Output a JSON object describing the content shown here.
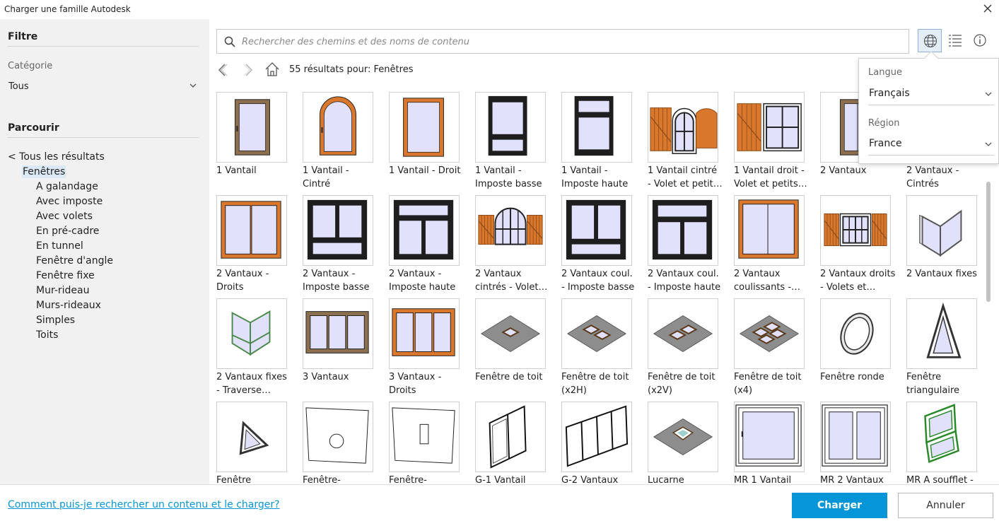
{
  "window": {
    "title": "Charger une famille Autodesk"
  },
  "sidebar": {
    "filter_heading": "Filtre",
    "category_label": "Catégorie",
    "category_value": "Tous",
    "browse_heading": "Parcourir",
    "all_results": "< Tous les résultats",
    "current": "Fenêtres",
    "subcategories": [
      "A galandage",
      "Avec imposte",
      "Avec volets",
      "En pré-cadre",
      "En tunnel",
      "Fenêtre d'angle",
      "Fenêtre fixe",
      "Mur-rideau",
      "Murs-rideaux",
      "Simples",
      "Toits"
    ]
  },
  "search": {
    "placeholder": "Rechercher des chemins et des noms de contenu",
    "value": ""
  },
  "results": {
    "count_text": "55 résultats",
    "pour": "pour:",
    "query": "Fenêtres"
  },
  "popup": {
    "language_label": "Langue",
    "language_value": "Français",
    "region_label": "Région",
    "region_value": "France"
  },
  "items": [
    {
      "l1": "1 Vantail",
      "l2": "",
      "icon": "window-1-vantail"
    },
    {
      "l1": "1 Vantail -",
      "l2": "Cintré",
      "icon": "window-arched"
    },
    {
      "l1": "1 Vantail - Droit",
      "l2": "",
      "icon": "window-1-droit"
    },
    {
      "l1": "1 Vantail -",
      "l2": "Imposte basse",
      "icon": "window-imposte-basse"
    },
    {
      "l1": "1 Vantail -",
      "l2": "Imposte haute",
      "icon": "window-imposte-haute"
    },
    {
      "l1": "1 Vantail cintré",
      "l2": "- Volet et petit…",
      "icon": "window-shutters-arched"
    },
    {
      "l1": "1 Vantail droit -",
      "l2": "Volet et petits…",
      "icon": "window-shutters"
    },
    {
      "l1": "2 Vantaux",
      "l2": "",
      "icon": "window-2-vantaux"
    },
    {
      "l1": "2 Vantaux -",
      "l2": "Cintrés",
      "icon": "window-2-cintres"
    },
    {
      "l1": "2 Vantaux -",
      "l2": "Droits",
      "icon": "window-2-droits"
    },
    {
      "l1": "2 Vantaux -",
      "l2": "Imposte basse",
      "icon": "window-2-imposte-basse"
    },
    {
      "l1": "2 Vantaux -",
      "l2": "Imposte haute",
      "icon": "window-2-imposte-haute"
    },
    {
      "l1": "2 Vantaux",
      "l2": "cintrés - Volet…",
      "icon": "window-2-shutters-arched"
    },
    {
      "l1": "2 Vantaux coul.",
      "l2": "- Imposte basse",
      "icon": "window-coul-basse"
    },
    {
      "l1": "2 Vantaux coul.",
      "l2": "- Imposte haute",
      "icon": "window-coul-haute"
    },
    {
      "l1": "2 Vantaux",
      "l2": "coulissants -…",
      "icon": "window-coulissants"
    },
    {
      "l1": "2 Vantaux droits",
      "l2": "- Volets et…",
      "icon": "window-2-shutters"
    },
    {
      "l1": "2 Vantaux fixes",
      "l2": "",
      "icon": "window-corner"
    },
    {
      "l1": "2 Vantaux fixes",
      "l2": "- Traverse…",
      "icon": "window-corner-traverse"
    },
    {
      "l1": "3 Vantaux",
      "l2": "",
      "icon": "window-3-vantaux"
    },
    {
      "l1": "3 Vantaux -",
      "l2": "Droits",
      "icon": "window-3-droits"
    },
    {
      "l1": "Fenêtre de toit",
      "l2": "",
      "icon": "roof-window"
    },
    {
      "l1": "Fenêtre de toit",
      "l2": "(x2H)",
      "icon": "roof-window-x2h"
    },
    {
      "l1": "Fenêtre de toit",
      "l2": "(x2V)",
      "icon": "roof-window-x2v"
    },
    {
      "l1": "Fenêtre de toit",
      "l2": "(x4)",
      "icon": "roof-window-x4"
    },
    {
      "l1": "Fenêtre ronde",
      "l2": "",
      "icon": "round-window"
    },
    {
      "l1": "Fenêtre",
      "l2": "triangulaire",
      "icon": "triangle-window"
    },
    {
      "l1": "Fenêtre",
      "l2": "",
      "icon": "triangle-small"
    },
    {
      "l1": "Fenêtre-",
      "l2": "",
      "icon": "panel-round-hole"
    },
    {
      "l1": "Fenêtre-",
      "l2": "",
      "icon": "panel-slot"
    },
    {
      "l1": "G-1 Vantail",
      "l2": "",
      "icon": "wire-g1"
    },
    {
      "l1": "G-2 Vantaux",
      "l2": "",
      "icon": "wire-g2"
    },
    {
      "l1": "Lucarne",
      "l2": "",
      "icon": "lucarne"
    },
    {
      "l1": "MR 1 Vantail",
      "l2": "",
      "icon": "mr-1"
    },
    {
      "l1": "MR 2 Vantaux",
      "l2": "",
      "icon": "mr-2"
    },
    {
      "l1": "MR A soufflet -",
      "l2": "",
      "icon": "mr-soufflet"
    }
  ],
  "footer": {
    "help_link": "Comment puis-je rechercher un contenu et le charger?",
    "load_label": "Charger",
    "cancel_label": "Annuler"
  },
  "colors": {
    "accent": "#0696d7",
    "wood": "#d9782d",
    "glass": "#e2e1fb"
  }
}
